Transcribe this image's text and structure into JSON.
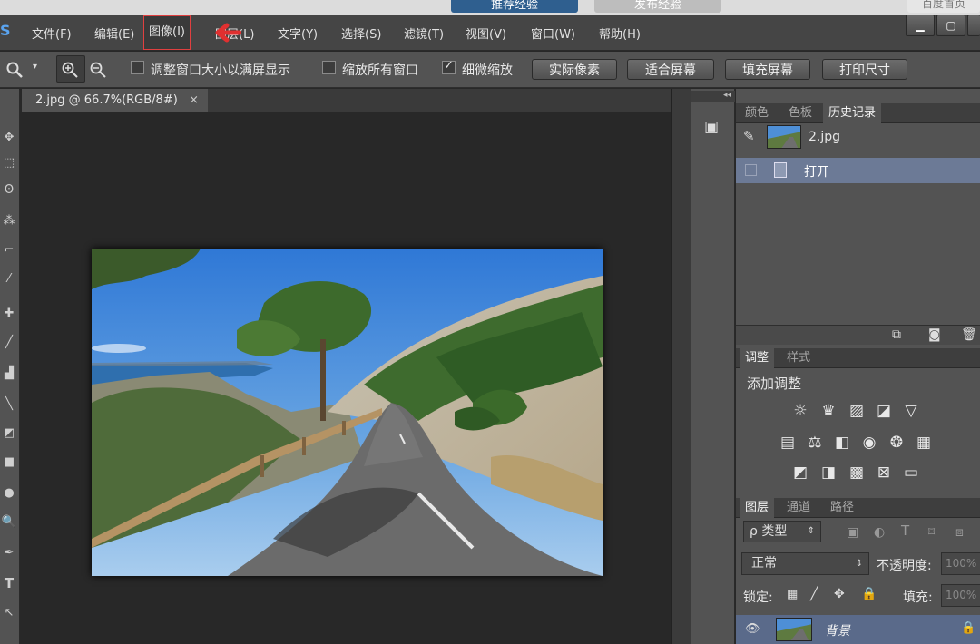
{
  "top_strip": {
    "tab1": "推荐经验",
    "tab2": "发布经验",
    "tab3": "百度首页"
  },
  "app": {
    "logo": "S"
  },
  "menu": [
    {
      "label": "文件(F)"
    },
    {
      "label": "编辑(E)"
    },
    {
      "label": "图像(I)"
    },
    {
      "label": "图层(L)"
    },
    {
      "label": "文字(Y)"
    },
    {
      "label": "选择(S)"
    },
    {
      "label": "滤镜(T)"
    },
    {
      "label": "视图(V)"
    },
    {
      "label": "窗口(W)"
    },
    {
      "label": "帮助(H)"
    }
  ],
  "window_controls": {
    "minimize": "▁",
    "maximize": "▢"
  },
  "options": {
    "resize_windows": {
      "label": "调整窗口大小以满屏显示",
      "checked": false
    },
    "zoom_all": {
      "label": "缩放所有窗口",
      "checked": false
    },
    "scrubby_zoom": {
      "label": "细微缩放",
      "checked": true
    },
    "buttons": [
      "实际像素",
      "适合屏幕",
      "填充屏幕",
      "打印尺寸"
    ]
  },
  "document": {
    "tab_title": "2.jpg @ 66.7%(RGB/8#)",
    "close": "×"
  },
  "history_panel": {
    "tabs": [
      "颜色",
      "色板",
      "历史记录"
    ],
    "active_tab": 2,
    "snapshot_name": "2.jpg",
    "items": [
      {
        "label": "打开"
      }
    ]
  },
  "adjustments_panel": {
    "tabs": [
      "调整",
      "样式"
    ],
    "active_tab": 0,
    "title": "添加调整",
    "icons": [
      "brightness-icon",
      "levels-icon",
      "curves-icon",
      "exposure-icon",
      "vibrance-icon",
      "hue-saturation-icon",
      "color-balance-icon",
      "black-white-icon",
      "photo-filter-icon",
      "channel-mixer-icon",
      "color-lookup-icon",
      "invert-icon",
      "posterize-icon",
      "threshold-icon",
      "selective-color-icon",
      "gradient-map-icon"
    ]
  },
  "layers_panel": {
    "tabs": [
      "图层",
      "通道",
      "路径"
    ],
    "active_tab": 0,
    "filter_label": "ρ 类型",
    "blend_mode": "正常",
    "opacity_label": "不透明度:",
    "opacity_value": "100%",
    "lock_label": "锁定:",
    "fill_label": "填充:",
    "fill_value": "100%",
    "layers": [
      {
        "name": "背景",
        "locked": true
      }
    ]
  },
  "colors": {
    "accent_active_menu": "#e04040",
    "selected_row": "#6c7a96"
  }
}
